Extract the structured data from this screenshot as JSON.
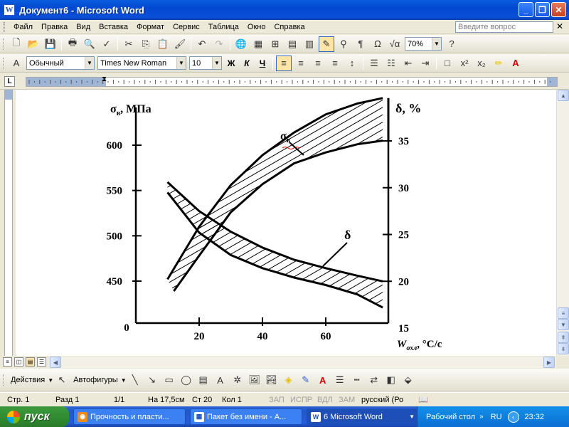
{
  "window": {
    "title": "Документ6 - Microsoft Word",
    "app_icon_letter": "W"
  },
  "menu": {
    "items": [
      "Файл",
      "Правка",
      "Вид",
      "Вставка",
      "Формат",
      "Сервис",
      "Таблица",
      "Окно",
      "Справка"
    ],
    "help_placeholder": "Введите вопрос"
  },
  "toolbar": {
    "zoom": "70%",
    "style": "Обычный",
    "font": "Times New Roman",
    "size": "10",
    "bold": "Ж",
    "italic": "К",
    "underline": "Ч",
    "omega": "Ω"
  },
  "chart_data": {
    "type": "line",
    "left_axis": {
      "label_main": "σ",
      "label_sub": "в",
      "label_unit": ", МПа",
      "ticks": [
        450,
        500,
        550,
        600
      ]
    },
    "right_axis": {
      "label": "δ, %",
      "ticks": [
        15,
        20,
        25,
        30,
        35
      ]
    },
    "x_axis": {
      "label_main": "W",
      "label_sub": "охл",
      "label_unit": ", °С/с",
      "ticks": [
        20,
        40,
        60
      ]
    },
    "origin_label": "0",
    "curve_labels": {
      "strength_main": "σ",
      "strength_sub": "в",
      "elongation": "δ"
    },
    "series": [
      {
        "name": "σв",
        "axis": "left",
        "kind": "band",
        "upper": [
          [
            10,
            452
          ],
          [
            20,
            510
          ],
          [
            30,
            556
          ],
          [
            40,
            589
          ],
          [
            50,
            614
          ],
          [
            60,
            634
          ],
          [
            70,
            646
          ],
          [
            78,
            652
          ]
        ],
        "lower": [
          [
            12,
            439
          ],
          [
            20,
            478
          ],
          [
            30,
            526
          ],
          [
            40,
            557
          ],
          [
            50,
            580
          ],
          [
            60,
            592
          ],
          [
            70,
            601
          ],
          [
            78,
            605
          ]
        ]
      },
      {
        "name": "δ",
        "axis": "right",
        "kind": "band",
        "upper": [
          [
            10,
            29.5
          ],
          [
            20,
            25.2
          ],
          [
            30,
            22.8
          ],
          [
            40,
            21.4
          ],
          [
            50,
            20.4
          ],
          [
            60,
            19.6
          ],
          [
            70,
            18.6
          ],
          [
            78,
            17.2
          ]
        ],
        "lower": [
          [
            10,
            30.6
          ],
          [
            20,
            27.5
          ],
          [
            30,
            25.3
          ],
          [
            40,
            23.6
          ],
          [
            50,
            22.3
          ],
          [
            60,
            21.4
          ],
          [
            70,
            20.6
          ],
          [
            78,
            20.0
          ]
        ]
      }
    ]
  },
  "drawing_toolbar": {
    "actions": "Действия",
    "autoshapes": "Автофигуры"
  },
  "status": {
    "page": "Стр. 1",
    "section": "Разд 1",
    "pages": "1/1",
    "at": "На 17,5см",
    "line": "Ст 20",
    "col": "Кол 1",
    "rec": "ЗАП",
    "trk": "ИСПР",
    "ext": "ВДЛ",
    "ovr": "ЗАМ",
    "lang": "русский (Ро"
  },
  "taskbar": {
    "start": "пуск",
    "tasks": [
      "Прочность и пласти...",
      "Пакет без имени - А...",
      "6 Microsoft Word"
    ],
    "desktop": "Рабочий стол",
    "lang": "RU",
    "time": "23:32"
  }
}
